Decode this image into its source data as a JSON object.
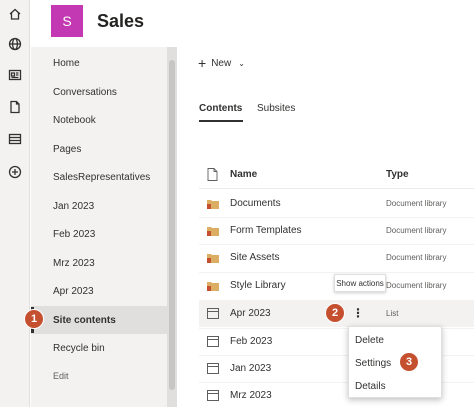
{
  "site": {
    "logo_letter": "S",
    "title": "Sales",
    "logo_color": "#c239b3"
  },
  "rail": {
    "icons": [
      "home-icon",
      "globe-icon",
      "news-icon",
      "document-icon",
      "list-icon",
      "add-circle-icon"
    ]
  },
  "nav": {
    "items": [
      {
        "label": "Home"
      },
      {
        "label": "Conversations"
      },
      {
        "label": "Notebook"
      },
      {
        "label": "Pages"
      },
      {
        "label": "SalesRepresentatives"
      },
      {
        "label": "Jan 2023"
      },
      {
        "label": "Feb 2023"
      },
      {
        "label": "Mrz 2023"
      },
      {
        "label": "Apr 2023"
      },
      {
        "label": "Site contents",
        "selected": true
      },
      {
        "label": "Recycle bin"
      }
    ],
    "edit_label": "Edit"
  },
  "command_bar": {
    "new_label": "New"
  },
  "tabs": [
    {
      "label": "Contents",
      "active": true
    },
    {
      "label": "Subsites",
      "active": false
    }
  ],
  "list": {
    "columns": {
      "name": "Name",
      "type": "Type"
    },
    "rows": [
      {
        "name": "Documents",
        "type": "Document library",
        "icon": "library-icon"
      },
      {
        "name": "Form Templates",
        "type": "Document library",
        "icon": "library-icon"
      },
      {
        "name": "Site Assets",
        "type": "Document library",
        "icon": "library-icon"
      },
      {
        "name": "Style Library",
        "type": "Document library",
        "icon": "library-icon"
      },
      {
        "name": "Apr 2023",
        "type": "List",
        "icon": "list-icon"
      },
      {
        "name": "Feb 2023",
        "type": "",
        "icon": "list-icon"
      },
      {
        "name": "Jan 2023",
        "type": "",
        "icon": "list-icon"
      },
      {
        "name": "Mrz 2023",
        "type": "",
        "icon": "list-icon"
      }
    ]
  },
  "tooltip": "Show actions",
  "context_menu": {
    "items": [
      {
        "label": "Delete"
      },
      {
        "label": "Settings"
      },
      {
        "label": "Details"
      }
    ]
  },
  "callouts": [
    "1",
    "2",
    "3"
  ],
  "accent_color": "#c4502f"
}
